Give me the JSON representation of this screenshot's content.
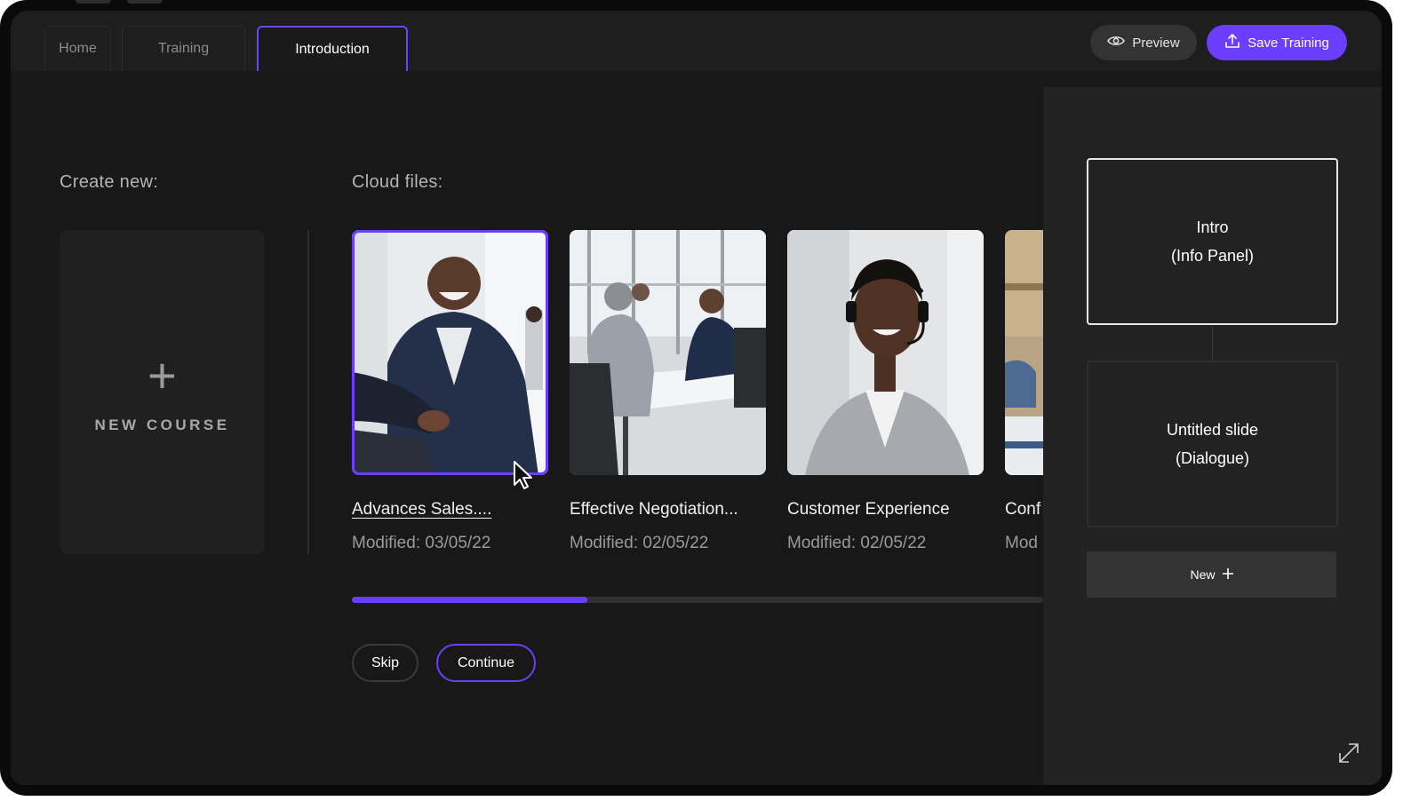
{
  "tabs": [
    {
      "label": "Home"
    },
    {
      "label": "Training"
    },
    {
      "label": "Introduction"
    }
  ],
  "header": {
    "preview_label": "Preview",
    "save_label": "Save Training"
  },
  "create_new": {
    "section_label": "Create new:",
    "new_course_label": "NEW COURSE"
  },
  "cloud_files": {
    "section_label": "Cloud files:",
    "items": [
      {
        "title": "Advances Sales....",
        "modified": "Modified: 03/05/22",
        "selected": true
      },
      {
        "title": "Effective Negotiation...",
        "modified": "Modified: 02/05/22"
      },
      {
        "title": "Customer Experience",
        "modified": "Modified: 02/05/22"
      },
      {
        "title": "Conf",
        "modified": "Mod"
      }
    ],
    "scroll_progress": 0.34
  },
  "actions": {
    "skip_label": "Skip",
    "continue_label": "Continue"
  },
  "slides_panel": {
    "slides": [
      {
        "title": "Intro",
        "subtitle": "(Info Panel)",
        "active": true
      },
      {
        "title": "Untitled slide",
        "subtitle": "(Dialogue)",
        "active": false
      }
    ],
    "new_label": "New"
  },
  "colors": {
    "accent": "#6b3dfc",
    "background": "#181818",
    "panel": "#222222"
  },
  "icons": [
    "eye-icon",
    "upload-icon",
    "plus-icon",
    "expand-icon",
    "cursor-icon"
  ]
}
